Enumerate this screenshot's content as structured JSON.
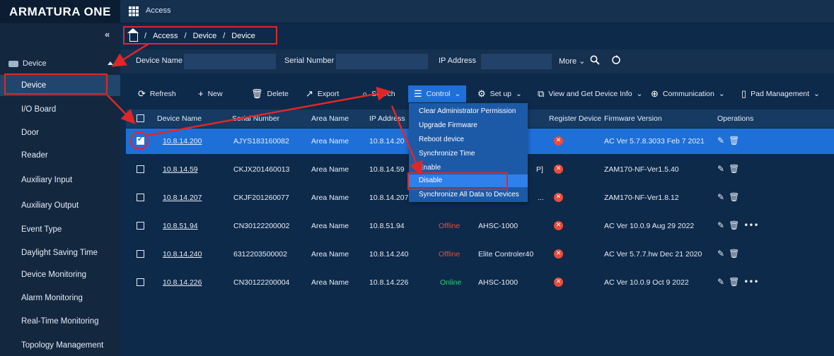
{
  "brand": "ARMATURA ONE",
  "module": "Access",
  "sidebar": {
    "collapse": "«",
    "group": "Device",
    "items": [
      {
        "label": "Device"
      },
      {
        "label": "I/O Board"
      },
      {
        "label": "Door"
      },
      {
        "label": "Reader"
      },
      {
        "label": "Auxiliary Input"
      },
      {
        "label": "Auxiliary Output"
      },
      {
        "label": "Event Type"
      },
      {
        "label": "Daylight Saving Time"
      },
      {
        "label": "Device Monitoring"
      },
      {
        "label": "Alarm Monitoring"
      },
      {
        "label": "Real-Time Monitoring"
      },
      {
        "label": "Topology Management"
      }
    ]
  },
  "breadcrumb": [
    "Access",
    "Device",
    "Device"
  ],
  "breadcrumb_sep": "/",
  "filters": {
    "device_name": "Device Name",
    "serial_number": "Serial Number",
    "ip_address": "IP Address",
    "more": "More"
  },
  "toolbar": {
    "refresh": "Refresh",
    "new": "New",
    "delete": "Delete",
    "export": "Export",
    "search": "Search",
    "control": "Control",
    "setup": "Set up",
    "view_get": "View and Get Device Info",
    "communication": "Communication",
    "pad": "Pad Management"
  },
  "table": {
    "headers": [
      "Device Name",
      "Serial Number",
      "Area Name",
      "IP Address",
      "Register Device",
      "Firmware Version",
      "Operations"
    ],
    "rows": [
      {
        "name": "10.8.14.200",
        "serial": "AJYS183160082",
        "area": "Area Name",
        "ip": "10.8.14.20",
        "status": "",
        "model": "",
        "firmware": "AC Ver 5.7.8.3033 Feb 7 2021",
        "more": false
      },
      {
        "name": "10.8.14.59",
        "serial": "CKJX201460013",
        "area": "Area Name",
        "ip": "10.8.14.59",
        "status": "",
        "model": "P]",
        "firmware": "ZAM170-NF-Ver1.5.40",
        "more": false
      },
      {
        "name": "10.8.14.207",
        "serial": "CKJF201260077",
        "area": "Area Name",
        "ip": "10.8.14.207",
        "status": "",
        "model": "...",
        "firmware": "ZAM170-NF-Ver1.8.12",
        "more": false
      },
      {
        "name": "10.8.51.94",
        "serial": "CN30122200002",
        "area": "Area Name",
        "ip": "10.8.51.94",
        "status": "Offline",
        "model": "AHSC-1000",
        "firmware": "AC Ver 10.0.9 Aug 29 2022",
        "more": true
      },
      {
        "name": "10.8.14.240",
        "serial": "6312203500002",
        "area": "Area Name",
        "ip": "10.8.14.240",
        "status": "Offline",
        "model": "Elite Controler40",
        "firmware": "AC Ver 5.7.7.hw Dec 21 2020",
        "more": false
      },
      {
        "name": "10.8.14.226",
        "serial": "CN30122200004",
        "area": "Area Name",
        "ip": "10.8.14.226",
        "status": "Online",
        "model": "AHSC-1000",
        "firmware": "AC Ver 10.0.9 Oct 9 2022",
        "more": true
      }
    ]
  },
  "control_menu": [
    "Clear Administrator Permission",
    "Upgrade Firmware",
    "Reboot device",
    "Synchronize Time",
    "Enable",
    "Disable",
    "Synchronize All Data to Devices"
  ],
  "colors": {
    "accent": "#1f6fd8",
    "annotation": "#e02727",
    "offline": "#e0503f",
    "online": "#2fd07a"
  }
}
